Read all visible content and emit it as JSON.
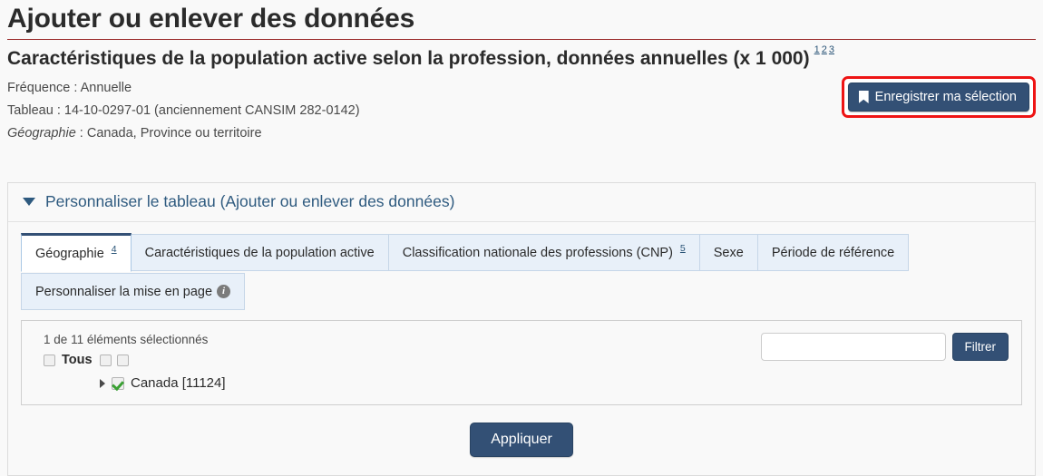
{
  "header": {
    "page_title": "Ajouter ou enlever des données",
    "subtitle": "Caractéristiques de la population active selon la profession, données annuelles (x 1 000)",
    "subtitle_footnotes": [
      "1",
      "2",
      "3"
    ],
    "meta": {
      "frequency_label": "Fréquence :",
      "frequency_value": "Annuelle",
      "table_label": "Tableau :",
      "table_value": "14-10-0297-01 (anciennement CANSIM 282-0142)",
      "geography_label": "Géographie",
      "geography_separator": " :",
      "geography_value": "Canada, Province ou territoire"
    },
    "save_selection_label": "Enregistrer ma sélection",
    "save_icon": "bookmark-icon",
    "highlight_color": "#ee1414"
  },
  "accordion": {
    "caret_icon": "triangle-down-icon",
    "title": "Personnaliser le tableau (Ajouter ou enlever des données)"
  },
  "tabs": {
    "row1": [
      {
        "label": "Géographie",
        "footnote": "4",
        "active": true
      },
      {
        "label": "Caractéristiques de la population active",
        "footnote": "",
        "active": false
      },
      {
        "label": "Classification nationale des professions (CNP)",
        "footnote": "5",
        "active": false
      },
      {
        "label": "Sexe",
        "footnote": "",
        "active": false
      },
      {
        "label": "Période de référence",
        "footnote": "",
        "active": false
      }
    ],
    "row2": [
      {
        "label": "Personnaliser la mise en page",
        "info_icon": "info-icon",
        "active": false
      }
    ]
  },
  "selection": {
    "count_selected": "1",
    "count_word": "de",
    "count_total": "11",
    "count_suffix": "éléments sélectionnés",
    "all_label": "Tous",
    "all_checkboxes": [
      "unchecked",
      "unchecked",
      "unchecked"
    ],
    "items": [
      {
        "label": "Canada [11124]",
        "checked": true,
        "expandable": true
      }
    ],
    "filter": {
      "value": "",
      "placeholder": "",
      "button_label": "Filtrer"
    }
  },
  "footer": {
    "apply_label": "Appliquer"
  },
  "colors": {
    "button_navy": "#335075",
    "accent_red": "#ee1414",
    "title_rule_red": "#9b2b2b",
    "link_blue": "#295376",
    "check_green": "#3aa033"
  }
}
